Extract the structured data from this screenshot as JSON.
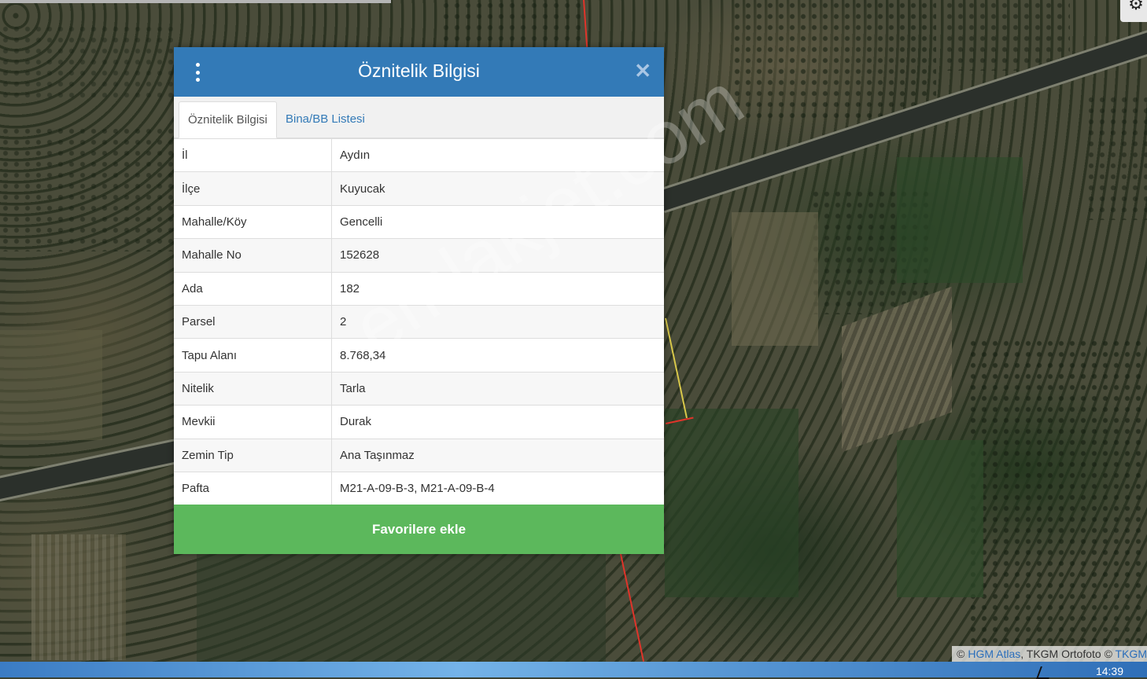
{
  "modal": {
    "title": "Öznitelik Bilgisi",
    "tabs": [
      {
        "label": "Öznitelik Bilgisi"
      },
      {
        "label": "Bina/BB Listesi"
      }
    ],
    "rows": [
      {
        "key": "İl",
        "value": "Aydın"
      },
      {
        "key": "İlçe",
        "value": "Kuyucak"
      },
      {
        "key": "Mahalle/Köy",
        "value": "Gencelli"
      },
      {
        "key": "Mahalle No",
        "value": "152628"
      },
      {
        "key": "Ada",
        "value": "182"
      },
      {
        "key": "Parsel",
        "value": "2"
      },
      {
        "key": "Tapu Alanı",
        "value": "8.768,34"
      },
      {
        "key": "Nitelik",
        "value": "Tarla"
      },
      {
        "key": "Mevkii",
        "value": "Durak"
      },
      {
        "key": "Zemin Tip",
        "value": "Ana Taşınmaz"
      },
      {
        "key": "Pafta",
        "value": "M21-A-09-B-3, M21-A-09-B-4"
      }
    ],
    "favorite_button": "Favorilere ekle",
    "close_symbol": "✕",
    "menu_icon": "kebab-menu-icon"
  },
  "map": {
    "watermark": "emlakjet.com",
    "attribution": {
      "copyright": "©",
      "link1": "HGM Atlas",
      "sep": ", TKGM Ortofoto ©",
      "link2": "TKGM"
    },
    "settings_icon": "gear-icon"
  },
  "taskbar": {
    "clock": "14:39"
  },
  "colors": {
    "header": "#337ab7",
    "favorite": "#5cb85c",
    "parcel_line": "#e0342a"
  }
}
